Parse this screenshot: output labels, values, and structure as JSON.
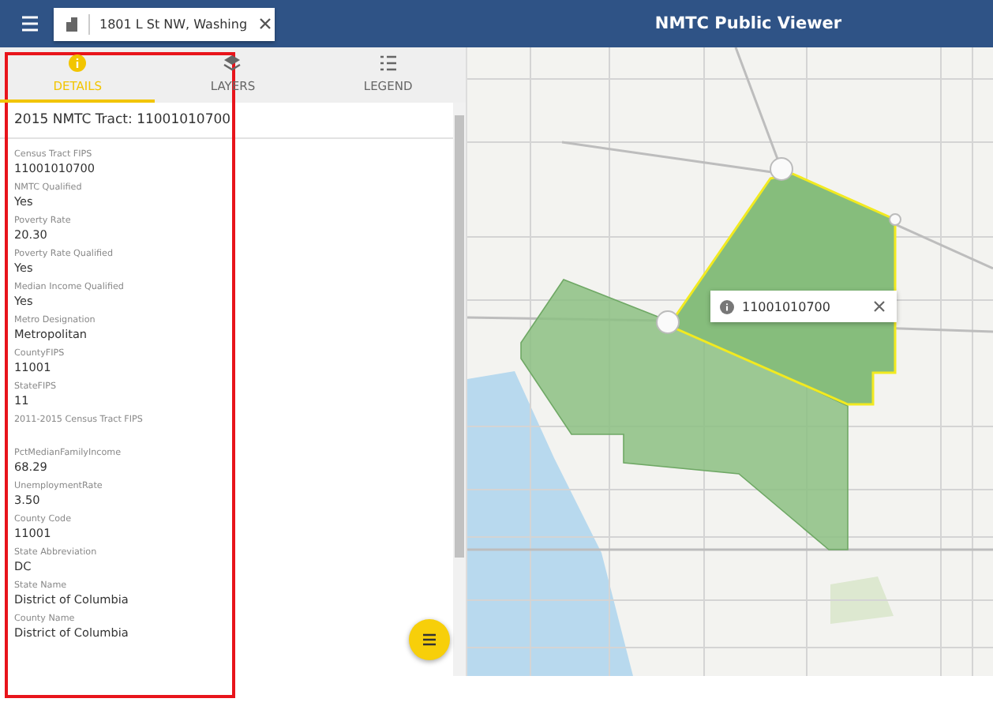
{
  "header": {
    "search_value": "1801 L St NW, Washing",
    "title": "NMTC Public Viewer"
  },
  "tabs": [
    {
      "label": "DETAILS",
      "kind": "info",
      "selected": true
    },
    {
      "label": "LAYERS",
      "kind": "layers",
      "selected": false
    },
    {
      "label": "LEGEND",
      "kind": "list",
      "selected": false
    }
  ],
  "panel": {
    "title": "2015 NMTC Tract: 11001010700",
    "fields": [
      {
        "label": "Census Tract FIPS",
        "value": "11001010700"
      },
      {
        "label": "NMTC Qualified",
        "value": "Yes"
      },
      {
        "label": "Poverty Rate",
        "value": "20.30"
      },
      {
        "label": "Poverty Rate Qualified",
        "value": "Yes"
      },
      {
        "label": "Median Income Qualified",
        "value": "Yes"
      },
      {
        "label": "Metro Designation",
        "value": "Metropolitan"
      },
      {
        "label": "CountyFIPS",
        "value": "11001"
      },
      {
        "label": "StateFIPS",
        "value": "11"
      },
      {
        "label": "2011-2015 Census Tract FIPS"
      },
      {
        "label": "PctMedianFamilyIncome",
        "value": "68.29"
      },
      {
        "label": "UnemploymentRate",
        "value": "3.50"
      },
      {
        "label": "County Code",
        "value": "11001"
      },
      {
        "label": "State Abbreviation",
        "value": "DC"
      },
      {
        "label": "State Name",
        "value": "District of Columbia"
      },
      {
        "label": "County Name",
        "value": "District of Columbia"
      }
    ]
  },
  "map": {
    "popup": {
      "text": "11001010700"
    }
  }
}
